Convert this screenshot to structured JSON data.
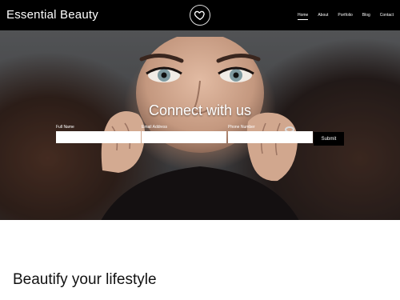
{
  "header": {
    "brand": "Essential Beauty",
    "logo_icon": "heart-icon",
    "nav": [
      {
        "label": "Home",
        "active": true
      },
      {
        "label": "About",
        "active": false
      },
      {
        "label": "Portfolio",
        "active": false
      },
      {
        "label": "Blog",
        "active": false
      },
      {
        "label": "Contact",
        "active": false
      }
    ]
  },
  "hero": {
    "title": "Connect with us",
    "form": {
      "full_name_label": "Full Name",
      "email_label": "Email Address",
      "phone_label": "Phone Number",
      "full_name_value": "",
      "email_value": "",
      "phone_value": "",
      "submit_label": "Submit"
    }
  },
  "section": {
    "title": "Beautify your lifestyle"
  },
  "colors": {
    "header_bg": "#000000",
    "button_bg": "#000000",
    "page_bg": "#ffffff"
  }
}
